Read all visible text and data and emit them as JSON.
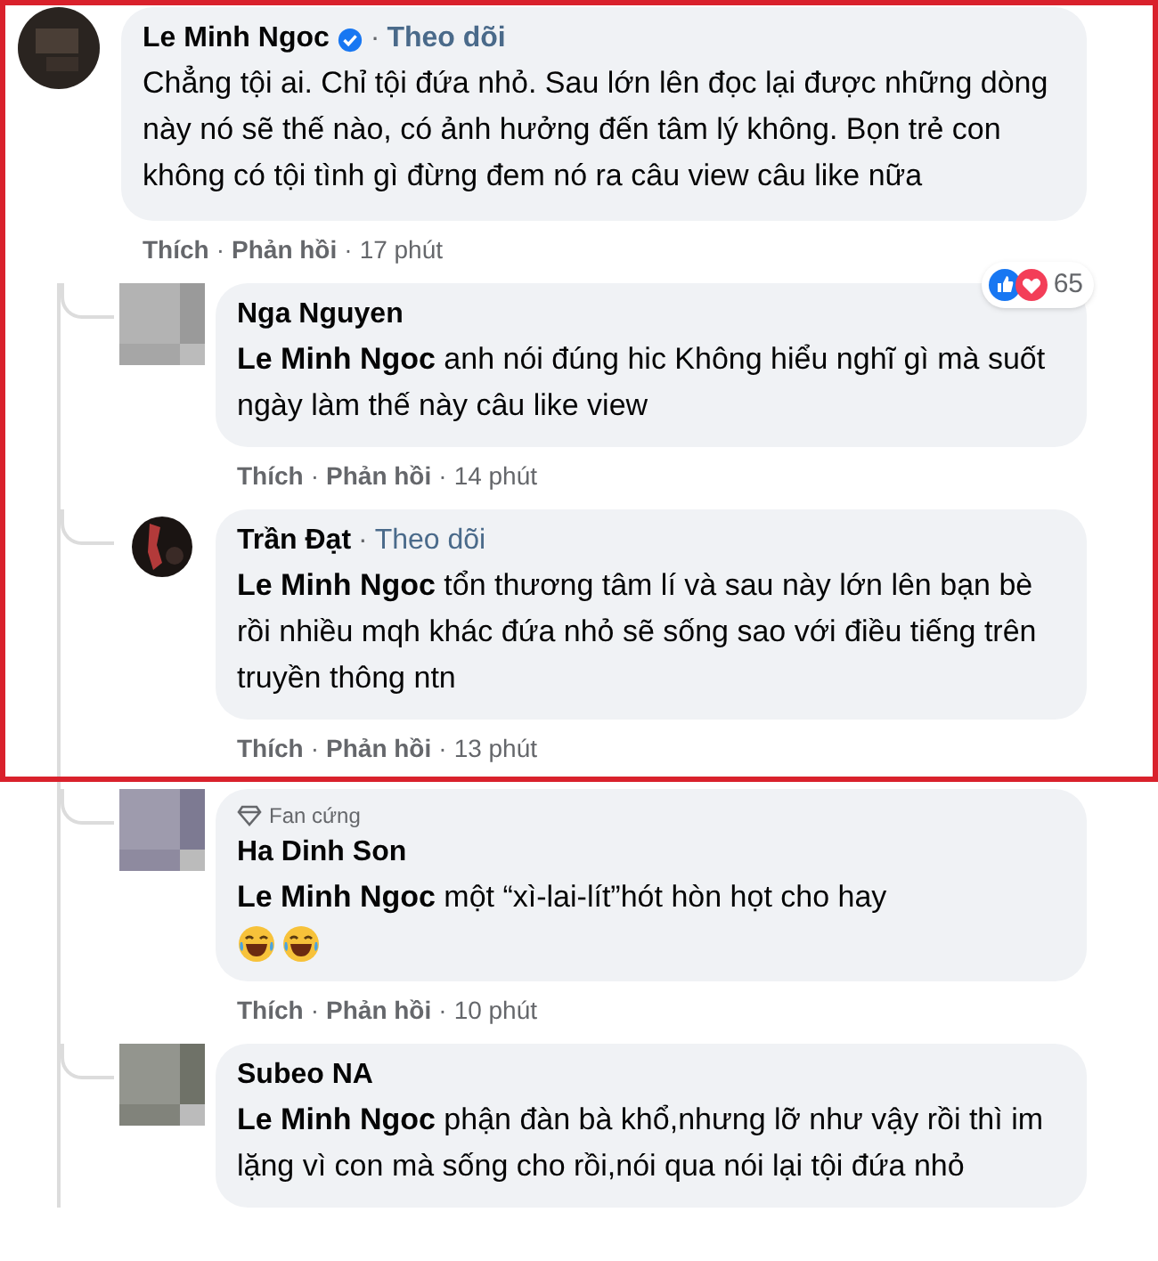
{
  "comment": {
    "author": "Le Minh Ngoc",
    "verified": true,
    "separator": "·",
    "follow": "Theo dõi",
    "text": "Chẳng tội ai. Chỉ tội đứa nhỏ. Sau lớn lên đọc lại được những dòng này nó sẽ thế nào, có ảnh hưởng đến tâm lý không. Bọn trẻ con không có tội tình gì đừng đem nó ra câu view câu like nữa",
    "actions": [
      "Thích",
      "Phản hồi"
    ],
    "time": "17 phút",
    "reactions": {
      "count": "65"
    }
  },
  "replies": [
    {
      "author": "Nga Nguyen",
      "text": "**Le Minh Ngoc** anh nói đúng hic Không hiểu nghĩ gì mà suốt ngày làm thế này câu like view",
      "actions": [
        "Thích",
        "Phản hồi"
      ],
      "time": "14 phút"
    },
    {
      "author": "Trần Đạt",
      "follow": "Theo dõi",
      "text": "**Le Minh Ngoc** tổn thương tâm lí và sau này lớn lên bạn bè rồi nhiều mqh khác đứa nhỏ sẽ sống sao với điều tiếng trên truyền thông ntn",
      "actions": [
        "Thích",
        "Phản hồi"
      ],
      "time": "13 phút"
    },
    {
      "author": "Ha Dinh Son",
      "badge": "Fan cứng",
      "text": "**Le Minh Ngoc** một “xì-lai-lít”hót hòn họt cho hay",
      "emojis": [
        {
          "kind": "laugh"
        },
        {
          "kind": "laugh"
        }
      ],
      "actions": [
        "Thích",
        "Phản hồi"
      ],
      "time": "10 phút"
    },
    {
      "author": "Subeo NA",
      "text": "**Le Minh Ngoc** phận đàn bà khổ,nhưng lỡ như vậy rồi thì im lặng vì con mà sống cho rồi,nói qua nói lại tội đứa nhỏ"
    }
  ]
}
